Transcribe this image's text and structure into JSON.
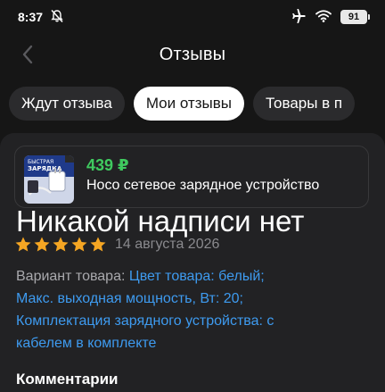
{
  "status_bar": {
    "time": "8:37",
    "battery": "91"
  },
  "header": {
    "title": "Отзывы"
  },
  "tabs": [
    {
      "label": "Ждут отзыва",
      "active": false
    },
    {
      "label": "Мои отзывы",
      "active": true
    },
    {
      "label": "Товары в п",
      "active": false
    }
  ],
  "review": {
    "product": {
      "price": "439 ₽",
      "name": "Hoco сетевое зарядное устройство",
      "thumb_text": "БЫСТРАЯ ЗАРЯДКА"
    },
    "overlay_text": "Никакой надписи нет",
    "rating": 5,
    "date": "14 августа 2026",
    "variant": {
      "label": "Вариант товара:",
      "value_line1": "Цвет товара: белый;",
      "value_line2": "Макс. выходная мощность, Вт: 20;",
      "value_line3": "Комплектация зарядного устройства: с",
      "value_line4": "кабелем в комплекте"
    },
    "comments_heading": "Комментарии"
  },
  "colors": {
    "background": "#161616",
    "card": "#222224",
    "accent_green": "#3fca5f",
    "link_blue": "#3e9bf0",
    "star_orange": "#f5a623"
  },
  "icons": [
    "mute-bell-icon",
    "airplane-icon",
    "wifi-icon",
    "battery-icon",
    "back-arrow-icon",
    "star-icon"
  ]
}
